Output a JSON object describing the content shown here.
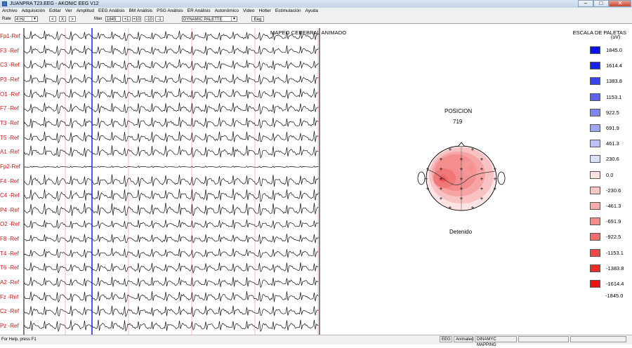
{
  "window": {
    "title": "JUANPRA T23.EEG - AKONIC EEG V12"
  },
  "menu": [
    "Archivo",
    "Adquisición",
    "Editar",
    "Ver",
    "Amplitud",
    "EEG Análisis",
    "BM Análisis",
    "PSG Análisis",
    "ER Análisis",
    "Autonómico",
    "Video",
    "Holter",
    "Estimulación",
    "Ayuda"
  ],
  "toolbar": {
    "rate_label": "Rate",
    "rate_value": "4 Hz",
    "prev_label": "<",
    "close_label": "X",
    "next_label": ">",
    "max_label": "Max",
    "max_value": "1845",
    "plus1_label": "+1",
    "plus10_label": "+10",
    "minus10_label": "-10",
    "minus1_label": "-1",
    "palette_value": "DYNAMIC PALETTE",
    "eeg_button_label": "Eeg"
  },
  "channels": [
    "Fp1-Ref",
    "F3 -Ref",
    "C3 -Ref",
    "P3 -Ref",
    "O1 -Ref",
    "F7 -Ref",
    "T3 -Ref",
    "T5 -Ref",
    "A1 -Ref",
    "Fp2-Ref",
    "F4 -Ref",
    "C4 -Ref",
    "P4 -Ref",
    "O2 -Ref",
    "F8 -Ref",
    "T4 -Ref",
    "T6 -Ref",
    "A2 -Ref",
    "Fz -Ref",
    "Cz -Ref",
    "Pz -Ref"
  ],
  "mapping": {
    "title": "MAPEO CEREBRAL ANIMADO",
    "position_label": "POSICION",
    "position_value": "719",
    "state": "Detenido"
  },
  "scale": {
    "title": "ESCALA DE PALETAS",
    "unit": "(uV)",
    "entries": [
      {
        "value": "1845.0",
        "color": "#0a12ef"
      },
      {
        "value": "1614.4",
        "color": "#1a22ef"
      },
      {
        "value": "1383.8",
        "color": "#3a42ee"
      },
      {
        "value": "1153.1",
        "color": "#5a62ee"
      },
      {
        "value": "922.5",
        "color": "#7e86f0"
      },
      {
        "value": "691.9",
        "color": "#9ea5f2"
      },
      {
        "value": "461.3",
        "color": "#bec3f5"
      },
      {
        "value": "230.6",
        "color": "#dcdff8"
      },
      {
        "value": "0.0",
        "color": "#fbe3e3"
      },
      {
        "value": "-230.6",
        "color": "#f8c6c6"
      },
      {
        "value": "-461.3",
        "color": "#f6aaaa"
      },
      {
        "value": "-691.9",
        "color": "#f48c8c"
      },
      {
        "value": "-922.5",
        "color": "#f26e6e"
      },
      {
        "value": "-1153.1",
        "color": "#f04848"
      },
      {
        "value": "-1383.8",
        "color": "#ee2a2a"
      },
      {
        "value": "-1614.4",
        "color": "#ec1010"
      }
    ],
    "last_value": "-1845.0"
  },
  "statusbar": {
    "help": "For Help, press F1",
    "panel1": "EEG",
    "panel2": "Animated",
    "panel3": "DINAMYC MAPPING"
  },
  "colors": {
    "channel_label": "#d01818",
    "cursor": "#1a1aff",
    "marker": "#ffb8b8"
  }
}
